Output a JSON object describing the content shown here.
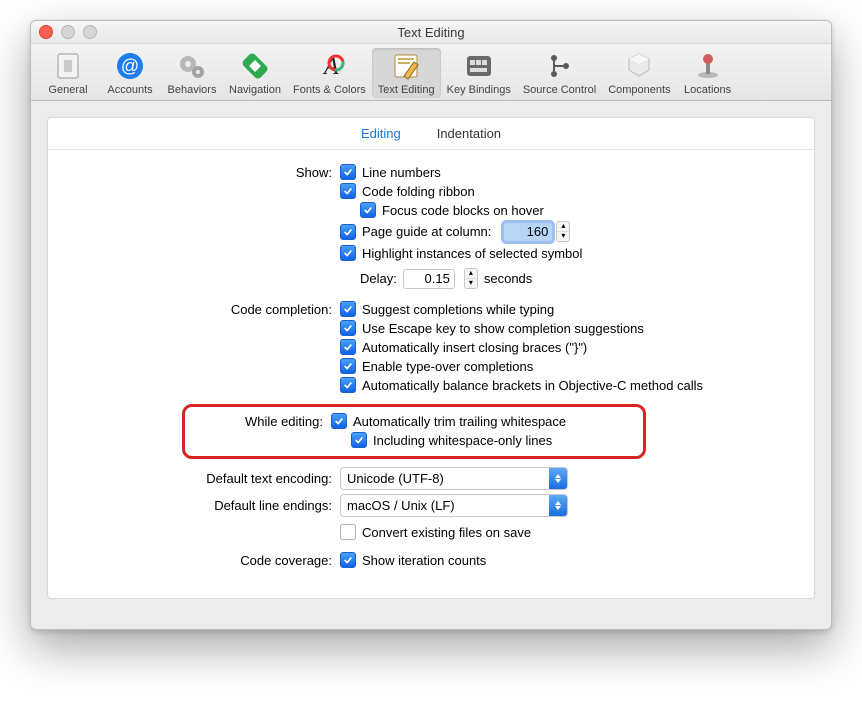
{
  "window": {
    "title": "Text Editing"
  },
  "toolbar": {
    "items": [
      {
        "label": "General"
      },
      {
        "label": "Accounts"
      },
      {
        "label": "Behaviors"
      },
      {
        "label": "Navigation"
      },
      {
        "label": "Fonts & Colors"
      },
      {
        "label": "Text Editing"
      },
      {
        "label": "Key Bindings"
      },
      {
        "label": "Source Control"
      },
      {
        "label": "Components"
      },
      {
        "label": "Locations"
      }
    ]
  },
  "tabs": {
    "editing": "Editing",
    "indentation": "Indentation"
  },
  "show": {
    "label": "Show:",
    "line_numbers": "Line numbers",
    "code_folding": "Code folding ribbon",
    "focus_hover": "Focus code blocks on hover",
    "page_guide": "Page guide at column:",
    "page_guide_value": "160",
    "highlight_symbol": "Highlight instances of selected symbol",
    "delay_label": "Delay:",
    "delay_value": "0.15",
    "delay_unit": "seconds"
  },
  "completion": {
    "label": "Code completion:",
    "suggest": "Suggest completions while typing",
    "escape": "Use Escape key to show completion suggestions",
    "braces": "Automatically insert closing braces (\"}\")",
    "typeover": "Enable type-over completions",
    "balance": "Automatically balance brackets in Objective-C method calls"
  },
  "editing": {
    "label": "While editing:",
    "trim": "Automatically trim trailing whitespace",
    "including": "Including whitespace-only lines"
  },
  "encoding": {
    "label": "Default text encoding:",
    "value": "Unicode (UTF-8)"
  },
  "lineendings": {
    "label": "Default line endings:",
    "value": "macOS / Unix (LF)",
    "convert": "Convert existing files on save"
  },
  "coverage": {
    "label": "Code coverage:",
    "show": "Show iteration counts"
  }
}
